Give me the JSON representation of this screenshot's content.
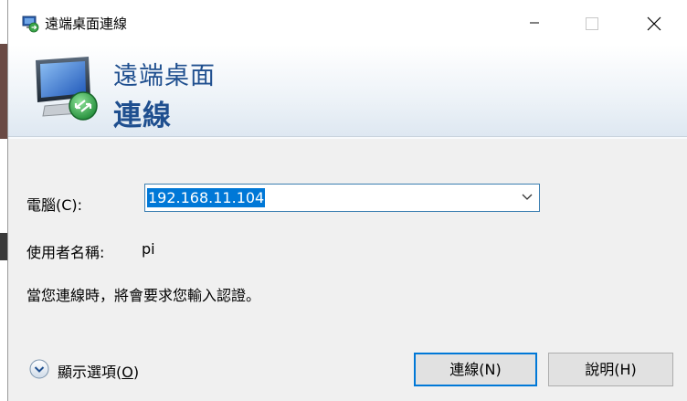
{
  "window": {
    "title": "遠端桌面連線"
  },
  "banner": {
    "line1": "遠端桌面",
    "line2": "連線"
  },
  "form": {
    "computer_label": "電腦(C):",
    "computer_value": "192.168.11.104",
    "user_label": "使用者名稱:",
    "user_value": "pi",
    "note": "當您連線時，將會要求您輸入認證。"
  },
  "footer": {
    "options_label": "顯示選項(",
    "options_hotkey": "O",
    "options_suffix": ")",
    "connect_label": "連線(N)",
    "help_label": "說明(H)"
  },
  "colors": {
    "accent": "#0078d7",
    "banner_text": "#1f4f8f",
    "selection": "#0078d7"
  },
  "icons": {
    "app": "remote-desktop-icon",
    "minimize": "minimize-icon",
    "maximize": "maximize-icon",
    "close": "close-icon",
    "dropdown": "chevron-down-icon",
    "options": "expand-circle-icon"
  }
}
